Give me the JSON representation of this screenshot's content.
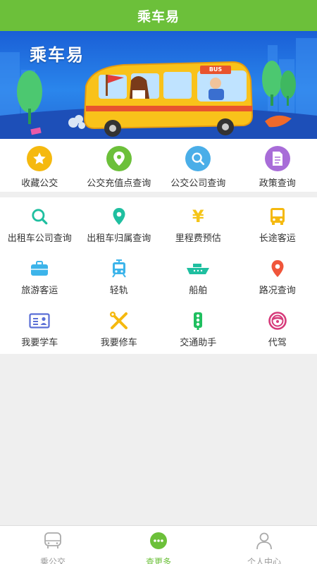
{
  "header": {
    "title": "乘车易"
  },
  "banner": {
    "title": "乘车易",
    "bus_sign": "BUS"
  },
  "top_menu": [
    {
      "label": "收藏公交",
      "icon": "star-icon",
      "color": "#f5b90f"
    },
    {
      "label": "公交充值点查询",
      "icon": "location-pin-icon",
      "color": "#6cc03a"
    },
    {
      "label": "公交公司查询",
      "icon": "search-icon",
      "color": "#4aaee8"
    },
    {
      "label": "政策查询",
      "icon": "document-icon",
      "color": "#a86cd8"
    }
  ],
  "more_menu": [
    {
      "label": "出租车公司查询",
      "icon": "search-icon",
      "color": "#1fbfa0"
    },
    {
      "label": "出租车归属查询",
      "icon": "location-pin-icon",
      "color": "#1fbfa0"
    },
    {
      "label": "里程费预估",
      "icon": "yen-icon",
      "color": "#f5c518"
    },
    {
      "label": "长途客运",
      "icon": "bus-icon",
      "color": "#f5b90f"
    },
    {
      "label": "旅游客运",
      "icon": "suitcase-icon",
      "color": "#3cb4ea"
    },
    {
      "label": "轻轨",
      "icon": "tram-icon",
      "color": "#3cb4ea"
    },
    {
      "label": "船舶",
      "icon": "ship-icon",
      "color": "#1fbfa0"
    },
    {
      "label": "路况查询",
      "icon": "location-pin-icon",
      "color": "#f0553a"
    },
    {
      "label": "我要学车",
      "icon": "license-card-icon",
      "color": "#5b6fd6"
    },
    {
      "label": "我要修车",
      "icon": "wrench-screwdriver-icon",
      "color": "#f5b90f"
    },
    {
      "label": "交通助手",
      "icon": "traffic-light-icon",
      "color": "#1fbf5f"
    },
    {
      "label": "代驾",
      "icon": "steering-wheel-icon",
      "color": "#d63a7a"
    }
  ],
  "tabbar": [
    {
      "label": "乘公交",
      "icon": "bus-icon",
      "active": false
    },
    {
      "label": "查更多",
      "icon": "more-dots-icon",
      "active": true
    },
    {
      "label": "个人中心",
      "icon": "person-icon",
      "active": false
    }
  ]
}
